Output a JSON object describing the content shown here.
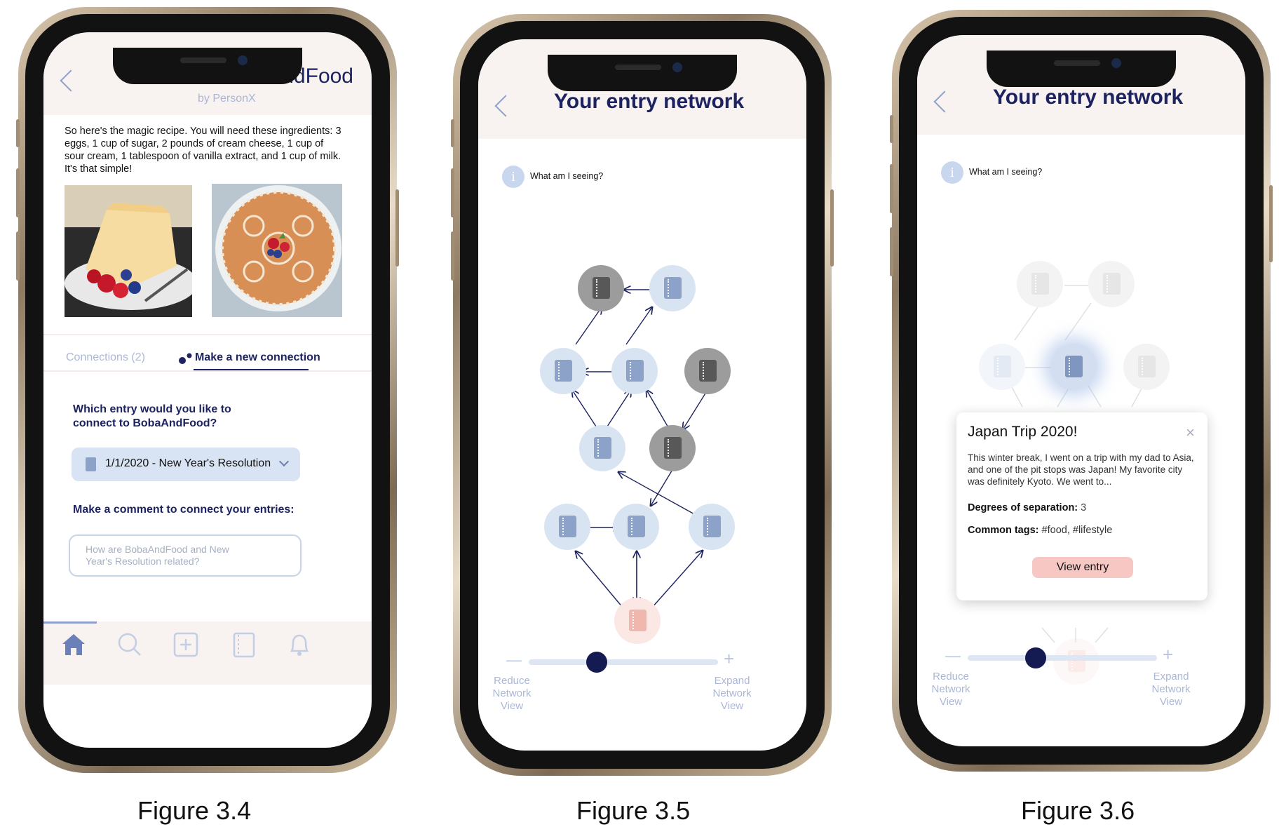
{
  "captions": [
    "Figure 3.4",
    "Figure 3.5",
    "Figure 3.6"
  ],
  "fig34": {
    "title": "BobaAndFood",
    "author": "by PersonX",
    "body": "So here's the magic recipe. You will need these ingredients: 3 eggs, 1 cup of sugar, 2 pounds of cream cheese, 1 cup of sour cream, 1 tablespoon of vanilla extract, and 1 cup of milk. It's that simple!",
    "tab_connections": "Connections (2)",
    "tab_new": "Make a new connection",
    "question": "Which entry would you like to connect to BobaAndFood?",
    "selected_entry": "1/1/2020 - New Year's Resolution",
    "comment_label": "Make a comment to connect your entries:",
    "comment_placeholder": "How are BobaAndFood and New Year's Resolution related?",
    "nav_icons": [
      "home-icon",
      "search-icon",
      "add-icon",
      "journal-icon",
      "bell-icon"
    ]
  },
  "fig35": {
    "title": "Your entry network",
    "info": "What am I seeing?",
    "reduce": "Reduce Network View",
    "expand": "Expand Network View",
    "minus": "—",
    "plus": "+",
    "slider_value": 0.36
  },
  "fig36": {
    "title": "Your entry network",
    "info": "What am I seeing?",
    "card_title": "Japan Trip 2020!",
    "card_body": "This winter break, I went on a trip with my dad to Asia, and one of the pit stops was Japan! My favorite city was definitely Kyoto. We went to...",
    "degrees_label": "Degrees of separation:",
    "degrees_value": "3",
    "tags_label": "Common tags:",
    "tags_value": "#food, #lifestyle",
    "view_button": "View entry",
    "close": "×",
    "reduce": "Reduce Network View",
    "expand": "Expand Network View",
    "minus": "—",
    "plus": "+",
    "slider_value": 0.36
  },
  "colors": {
    "navy": "#1c2360",
    "light_blue": "#d9e4f3",
    "header_bg": "#f8f2f0",
    "pink_button": "#f6c7c3"
  }
}
